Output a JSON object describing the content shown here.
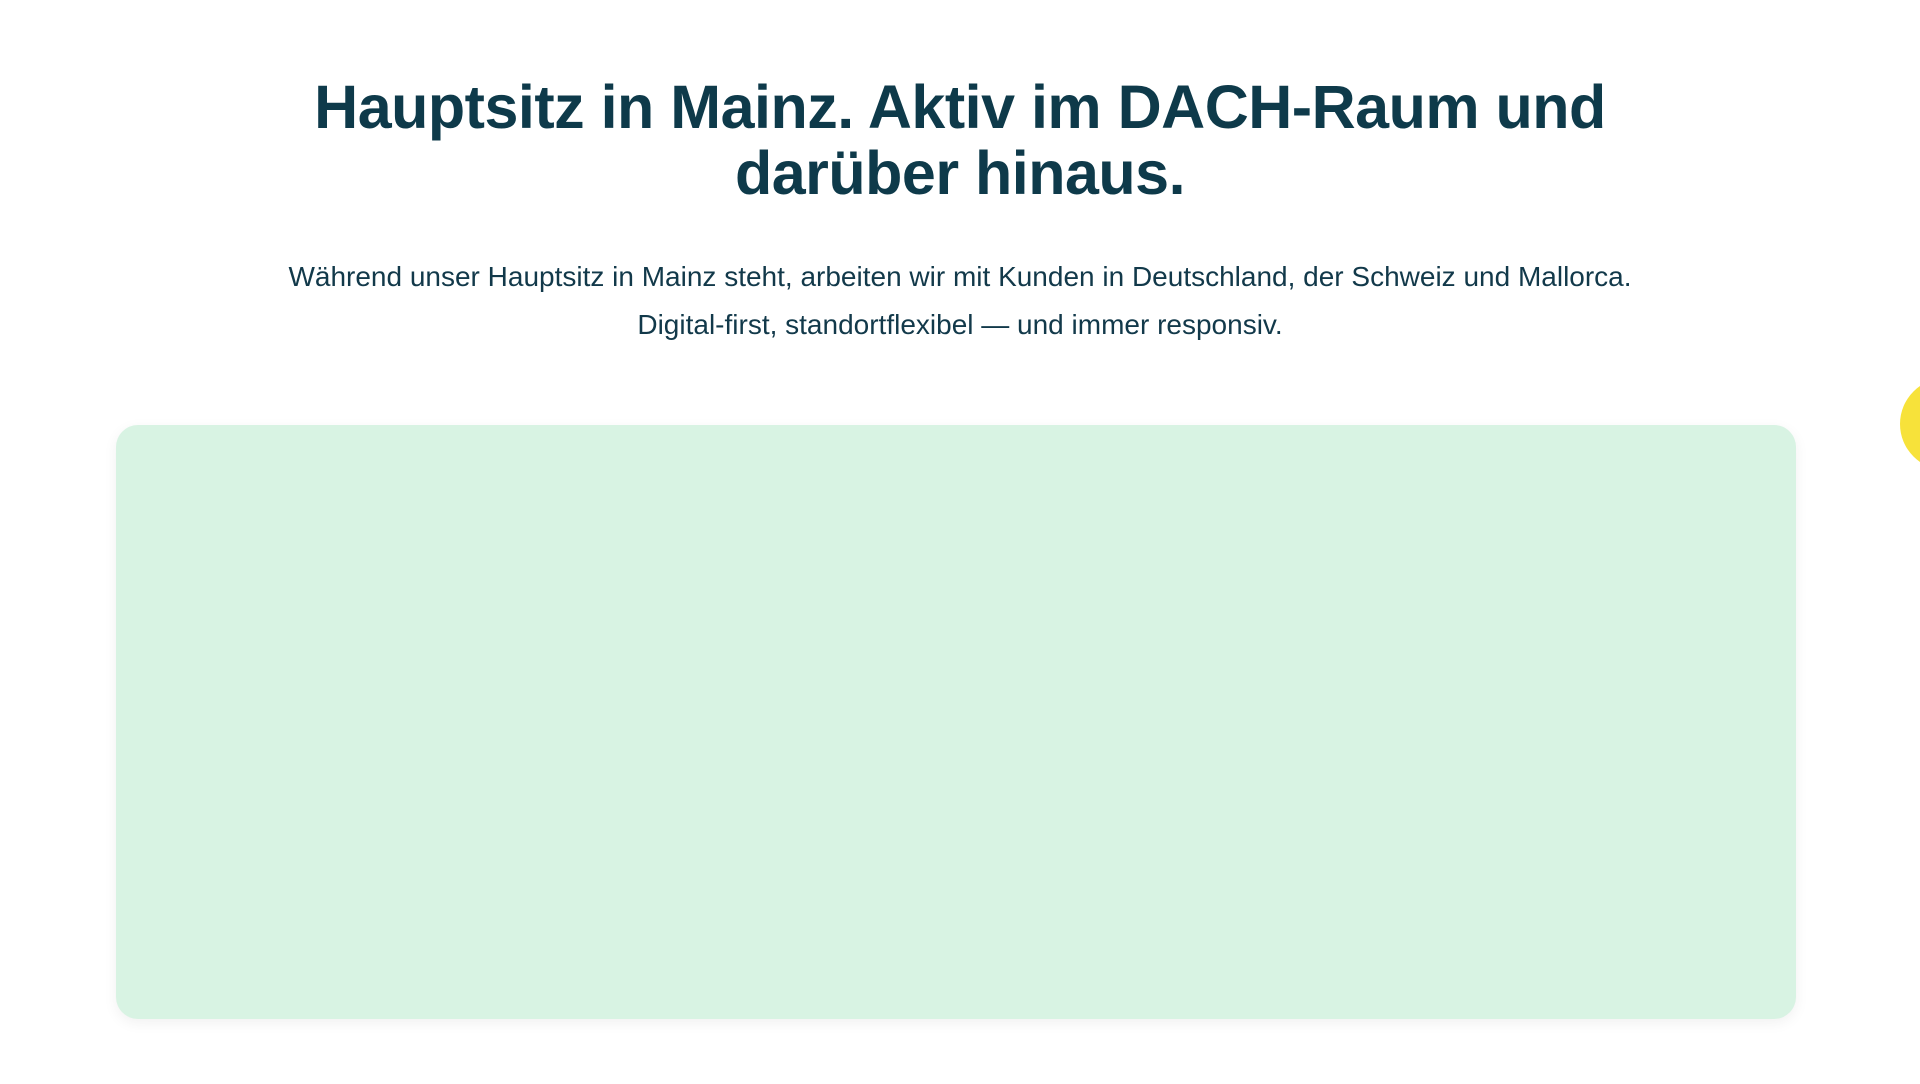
{
  "hero": {
    "title_line_1": "Hauptsitz in Mainz. Aktiv im DACH-Raum und",
    "title_line_2": "darüber hinaus.",
    "subtitle_line_1": "Während unser Hauptsitz in Mainz steht, arbeiten wir mit Kunden in Deutschland, der Schweiz und Mallorca.",
    "subtitle_line_2": "Digital-first, standortflexibel — und immer responsiv."
  },
  "colors": {
    "heading": "#0e3a4a",
    "text": "#12394a",
    "panel_background": "#d8f3e3",
    "accent_yellow": "#f7e23a"
  }
}
